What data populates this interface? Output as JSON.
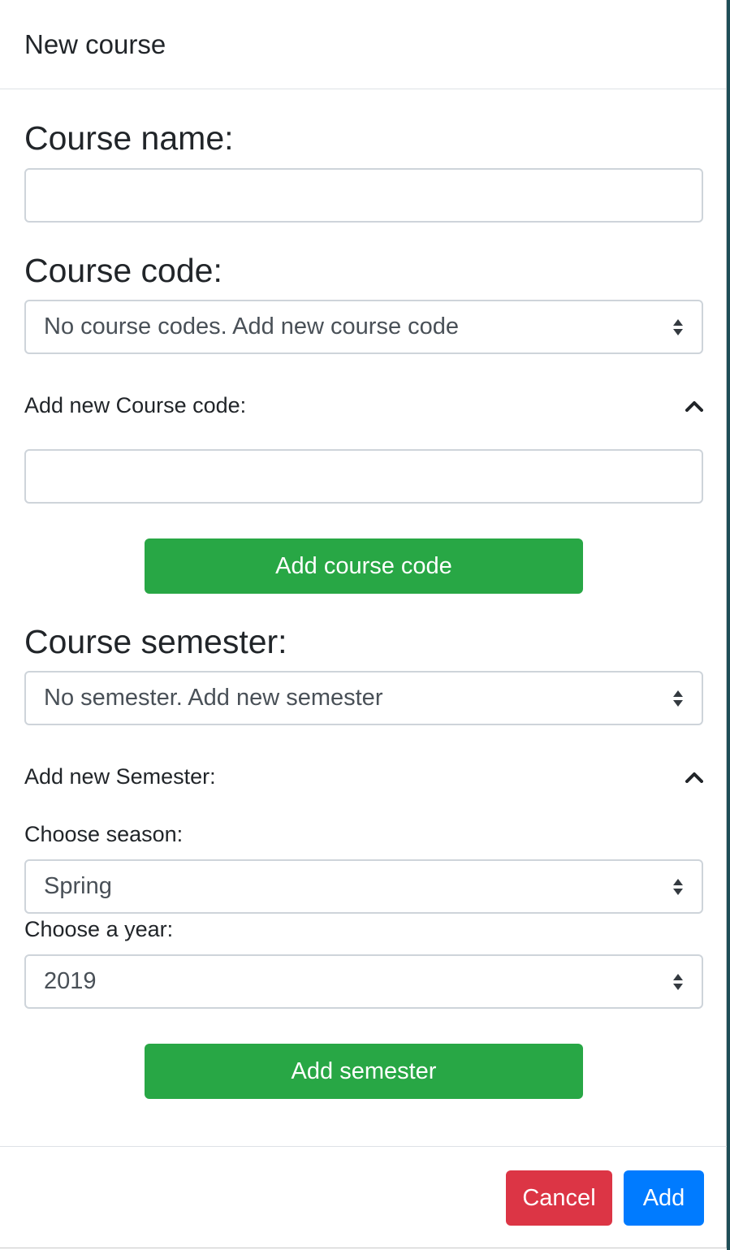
{
  "modal": {
    "title": "New course",
    "course_name": {
      "label": "Course name:",
      "value": ""
    },
    "course_code": {
      "label": "Course code:",
      "select_value": "No course codes. Add new course code",
      "add_new_label": "Add new Course code:",
      "new_value": "",
      "add_button": "Add course code"
    },
    "course_semester": {
      "label": "Course semester:",
      "select_value": "No semester. Add new semester",
      "add_new_label": "Add new Semester:",
      "season_label": "Choose season:",
      "season_value": "Spring",
      "year_label": "Choose a year:",
      "year_value": "2019",
      "add_button": "Add semester"
    },
    "footer": {
      "cancel": "Cancel",
      "add": "Add"
    }
  },
  "colors": {
    "success": "#28a745",
    "danger": "#dc3545",
    "primary": "#007bff"
  },
  "icons": [
    "select-arrows-icon",
    "chevron-up-icon"
  ]
}
